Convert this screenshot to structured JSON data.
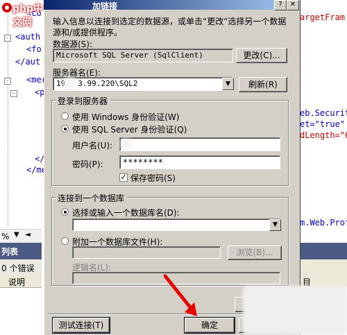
{
  "watermark": {
    "logo_text": "php中文网"
  },
  "dialog": {
    "title": "加链接",
    "intro_text_1": "输入信息以连接到选定的数据源，或单击“更改”选择另一个数据",
    "intro_text_2": "源和/或提供程序。",
    "data_source_label": "数据源(S):",
    "data_source_value": "Microsoft SQL Server (SqlClient)",
    "change_button": "更改(C)...",
    "server_name_label": "服务器名(E):",
    "server_name_value_prefix": "19",
    "server_name_value_suffix": "3.99.220\\SQL2",
    "refresh_button": "刷新(R)",
    "login_group_label": "登录到服务器",
    "windows_auth_label": "使用 Windows 身份验证(W)",
    "sql_auth_label": "使用 SQL Server 身份验证(Q)",
    "auth_selected": "sql",
    "username_label": "用户名(U):",
    "username_value": "",
    "password_label": "密码(P):",
    "password_value": "********",
    "save_password_label": "保存密码(S)",
    "save_password_checked": true,
    "db_group_label": "连接到一个数据库",
    "select_db_label": "选择或输入一个数据库名(D):",
    "select_db_value": "",
    "attach_db_label": "附加一个数据库文件(H):",
    "browse_button": "浏览(B)...",
    "logical_name_label": "逻辑名(L):",
    "advanced_button": "高",
    "test_connection_button": "测试连接(T)",
    "ok_button": "确定",
    "help_button": "?"
  },
  "background": {
    "left_code_lines": [
      "<co",
      "<auth",
      "<fo",
      "</aut",
      "<mer",
      "<p",
      "</",
      "</me"
    ],
    "right_code_lines": [
      "argetFram",
      "eb.Securit",
      "et=\"true\"",
      "dLength=\"6",
      "m.Web.Prof"
    ],
    "zoom_text": "%",
    "error_list_title": "列表",
    "error_count": "0 个错误",
    "desc_column": "说明",
    "right_column": "目"
  },
  "colors": {
    "title_start": "#0a246a",
    "title_end": "#a6caf0",
    "panel_title": "#4b5b84",
    "arrow": "#e60000"
  }
}
